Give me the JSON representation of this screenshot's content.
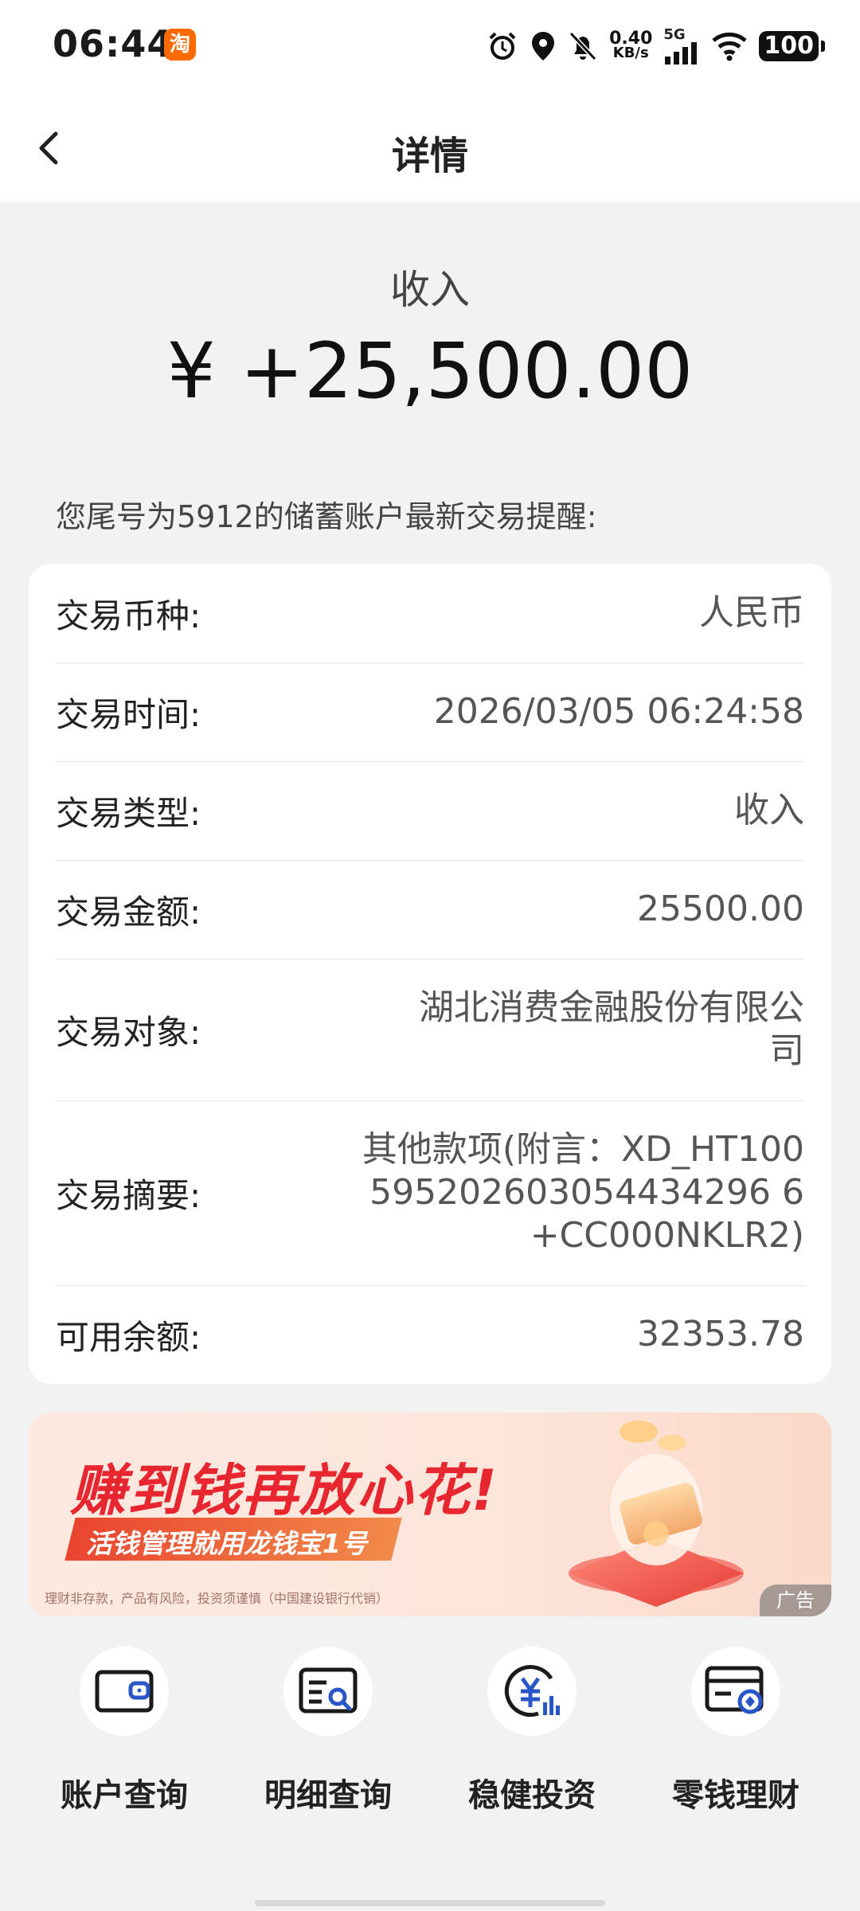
{
  "status_bar": {
    "time": "06:44",
    "app_badge": "淘",
    "speed_value": "0.40",
    "speed_unit": "KB/s",
    "network": "5G",
    "battery": "100",
    "icons": [
      "alarm-icon",
      "location-icon",
      "bell-muted-icon",
      "signal-icon",
      "wifi-icon",
      "battery-icon"
    ]
  },
  "nav": {
    "title": "详情",
    "back_icon": "chevron-left-icon"
  },
  "hero": {
    "type_label": "收入",
    "amount": "¥ +25,500.00"
  },
  "notice": "您尾号为5912的储蓄账户最新交易提醒:",
  "details": [
    {
      "label": "交易币种:",
      "value": "人民币"
    },
    {
      "label": "交易时间:",
      "value": "2026/03/05 06:24:58"
    },
    {
      "label": "交易类型:",
      "value": "收入"
    },
    {
      "label": "交易金额:",
      "value": "25500.00"
    },
    {
      "label": "交易对象:",
      "value": "湖北消费金融股份有限公司"
    },
    {
      "label": "交易摘要:",
      "value": "其他款项(附言：XD_HT100595202603054434296 6+CC000NKLR2)"
    },
    {
      "label": "可用余额:",
      "value": "32353.78"
    }
  ],
  "banner": {
    "headline": "赚到钱再放心花!",
    "subline": "活钱管理就用龙钱宝1号",
    "disclaimer": "理财非存款，产品有风险，投资须谨慎（中国建设银行代销）",
    "ad_tag": "广告"
  },
  "shortcuts": [
    {
      "label": "账户查询",
      "icon": "wallet-icon"
    },
    {
      "label": "明细查询",
      "icon": "list-search-icon"
    },
    {
      "label": "稳健投资",
      "icon": "yuan-chart-icon"
    },
    {
      "label": "零钱理财",
      "icon": "card-coin-icon"
    }
  ],
  "colors": {
    "brand_red": "#e8262f",
    "icon_blue": "#2a55c9",
    "background": "#f2f2f2"
  }
}
